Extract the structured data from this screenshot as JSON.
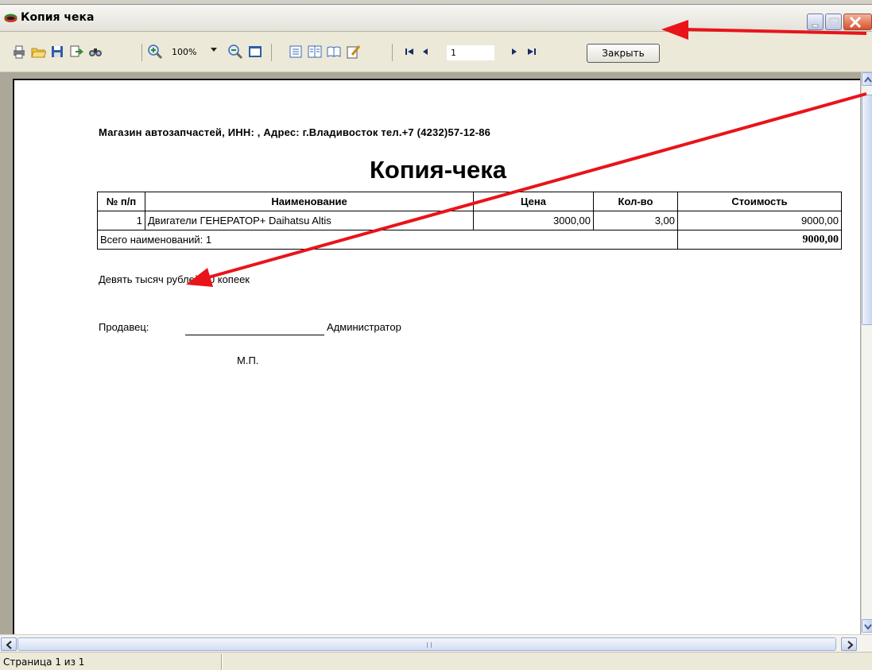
{
  "window": {
    "title": "Копия чека"
  },
  "toolbar": {
    "zoom_value": "100%",
    "page_value": "1",
    "close_label": "Закрыть"
  },
  "document": {
    "store_info": "Магазин автозапчастей, ИНН: , Адрес: г.Владивосток тел.+7 (4232)57-12-86",
    "title": "Копия-чека",
    "table": {
      "headers": [
        "№ п/п",
        "Наименование",
        "Цена",
        "Кол-во",
        "Стоимость"
      ],
      "rows": [
        [
          "1",
          "Двигатели ГЕНЕРАТОР+ Daihatsu Altis",
          "3000,00",
          "3,00",
          "9000,00"
        ]
      ],
      "total_label": "Всего наименований: 1",
      "total_value": "9000,00"
    },
    "amount_words": "Девять тысяч рублей 00 копеек",
    "seller_label": "Продавец:",
    "seller_role": "Администратор",
    "stamp": "М.П."
  },
  "status": {
    "page_info": "Страница 1 из 1"
  },
  "colors": {
    "annotation_arrow": "#e8141a",
    "close_button": "#d8502c"
  }
}
